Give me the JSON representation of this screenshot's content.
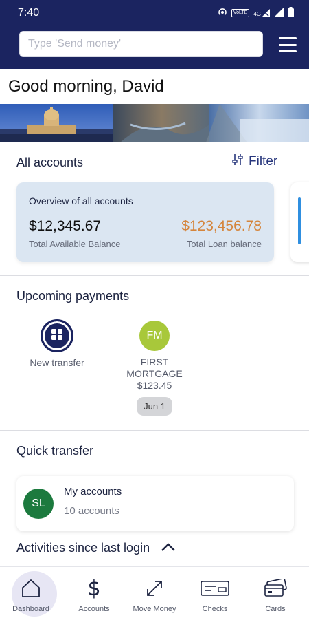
{
  "status_bar": {
    "time": "7:40",
    "icons": [
      "hotspot-icon",
      "volte-icon",
      "signal-4g-icon",
      "signal-bars-icon",
      "battery-icon"
    ],
    "volte_text": "VoLTE",
    "network_text": "4G"
  },
  "header": {
    "search_placeholder": "Type 'Send money'",
    "menu_icon": "hamburger-menu-icon"
  },
  "greeting": "Good morning, David",
  "accounts": {
    "title": "All accounts",
    "filter_label": "Filter",
    "overview": {
      "title": "Overview of all accounts",
      "available_balance": "$12,345.67",
      "available_label": "Total Available Balance",
      "loan_balance": "$123,456.78",
      "loan_label": "Total Loan balance"
    }
  },
  "upcoming_payments": {
    "title": "Upcoming payments",
    "new_transfer_label": "New transfer",
    "items": [
      {
        "initials": "FM",
        "name_line1": "FIRST",
        "name_line2": "MORTGAGE",
        "amount": "$123.45",
        "date": "Jun 1"
      }
    ]
  },
  "quick_transfer": {
    "title": "Quick transfer",
    "initials": "SL",
    "account_title": "My accounts",
    "account_sub": "10 accounts"
  },
  "activities": {
    "title": "Activities since last login",
    "icon": "chevron-up-icon"
  },
  "nav": {
    "items": [
      {
        "label": "Dashboard",
        "icon": "home-icon",
        "active": true
      },
      {
        "label": "Accounts",
        "icon": "dollar-icon",
        "active": false
      },
      {
        "label": "Move Money",
        "icon": "move-arrows-icon",
        "active": false
      },
      {
        "label": "Checks",
        "icon": "check-icon",
        "active": false
      },
      {
        "label": "Cards",
        "icon": "cards-icon",
        "active": false
      }
    ]
  },
  "colors": {
    "brand_navy": "#1b2460",
    "loan_orange": "#d5853c",
    "fm_green": "#a8c83a",
    "sl_green": "#1c7a3e",
    "overview_bg": "#dbe6f2"
  }
}
